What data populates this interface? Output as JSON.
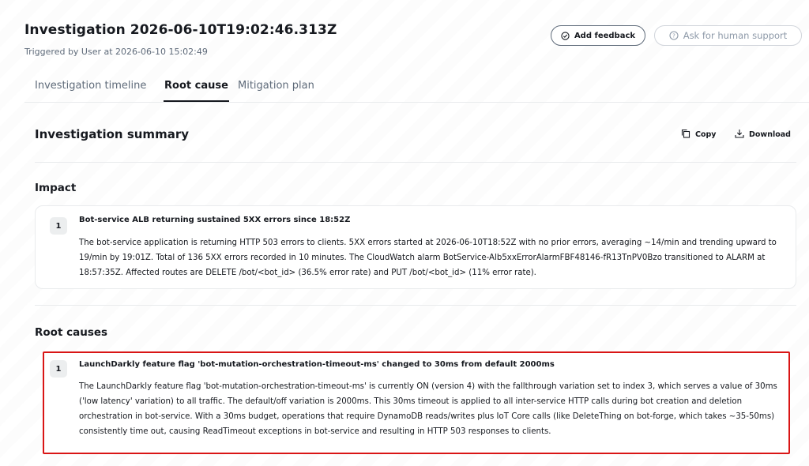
{
  "header": {
    "title": "Investigation 2026-06-10T19:02:46.313Z",
    "subtitle": "Triggered by User at 2026-06-10 15:02:49",
    "add_feedback_label": "Add feedback",
    "human_support_label": "Ask for human support"
  },
  "tabs": [
    {
      "label": "Investigation timeline",
      "active": false
    },
    {
      "label": "Root cause",
      "active": true
    },
    {
      "label": "Mitigation plan",
      "active": false
    }
  ],
  "summary": {
    "title": "Investigation summary",
    "copy_label": "Copy",
    "download_label": "Download"
  },
  "impact": {
    "title": "Impact",
    "items": [
      {
        "number": "1",
        "heading": "Bot-service ALB returning sustained 5XX errors since 18:52Z",
        "body": "The bot-service application is returning HTTP 503 errors to clients. 5XX errors started at 2026-06-10T18:52Z with no prior errors, averaging ~14/min and trending upward to 19/min by 19:01Z. Total of 136 5XX errors recorded in 10 minutes. The CloudWatch alarm BotService-Alb5xxErrorAlarmFBF48146-fR13TnPV0Bzo transitioned to ALARM at 18:57:35Z. Affected routes are DELETE /bot/<bot_id> (36.5% error rate) and PUT /bot/<bot_id> (11% error rate)."
      }
    ]
  },
  "root_causes": {
    "title": "Root causes",
    "items": [
      {
        "number": "1",
        "heading": "LaunchDarkly feature flag 'bot-mutation-orchestration-timeout-ms' changed to 30ms from default 2000ms",
        "body": "The LaunchDarkly feature flag 'bot-mutation-orchestration-timeout-ms' is currently ON (version 4) with the fallthrough variation set to index 3, which serves a value of 30ms ('low latency' variation) to all traffic. The default/off variation is 2000ms. This 30ms timeout is applied to all inter-service HTTP calls during bot creation and deletion orchestration in bot-service. With a 30ms budget, operations that require DynamoDB reads/writes plus IoT Core calls (like DeleteThing on bot-forge, which takes ~35-50ms) consistently time out, causing ReadTimeout exceptions in bot-service and resulting in HTTP 503 responses to clients."
      }
    ]
  },
  "colors": {
    "highlight_border": "#d91515",
    "text_primary": "#16191f",
    "text_secondary": "#5f6b7a"
  }
}
